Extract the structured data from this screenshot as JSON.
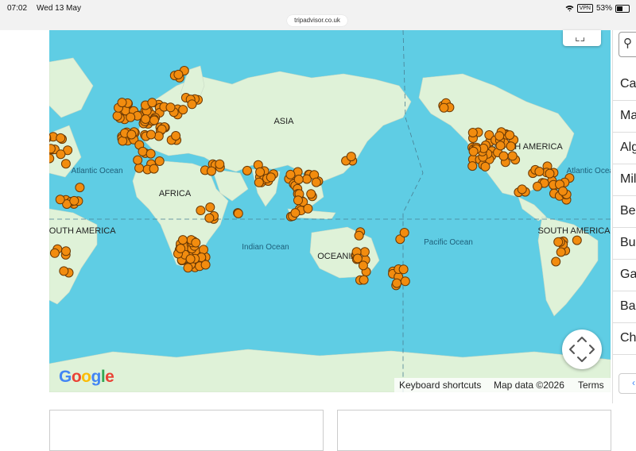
{
  "status_bar": {
    "time": "07:02",
    "date": "Wed 13 May",
    "url": "tripadvisor.co.uk",
    "vpn": "VPN",
    "battery": "53%",
    "battery_level": 0.53
  },
  "map": {
    "continent_labels": [
      "ASIA",
      "AFRICA",
      "OCEANIA",
      "SOUTH AMERICA",
      "SOUTH AMERICA",
      "NORTH AMERICA"
    ],
    "ocean_labels": [
      "Atlantic Ocean",
      "Atlantic Ocean",
      "Indian Ocean",
      "Pacific Ocean"
    ],
    "google_logo": "Google",
    "attribution": {
      "keyboard_shortcuts": "Keyboard shortcuts",
      "map_data": "Map data ©2026",
      "terms": "Terms"
    },
    "colors": {
      "water": "#5fcde4",
      "land": "#dff2d8",
      "marker": "#f28c0f",
      "marker_stroke": "#6b3a05"
    }
  },
  "side_list": {
    "items": [
      "Ca",
      "Ma",
      "Alg",
      "Mil",
      "Ber",
      "Bur",
      "Ga",
      "Bal",
      "Ch"
    ]
  },
  "icons": [
    "search-icon",
    "fullscreen-icon",
    "pan-control-icon",
    "chevron-left-icon",
    "wifi-icon",
    "battery-icon"
  ]
}
